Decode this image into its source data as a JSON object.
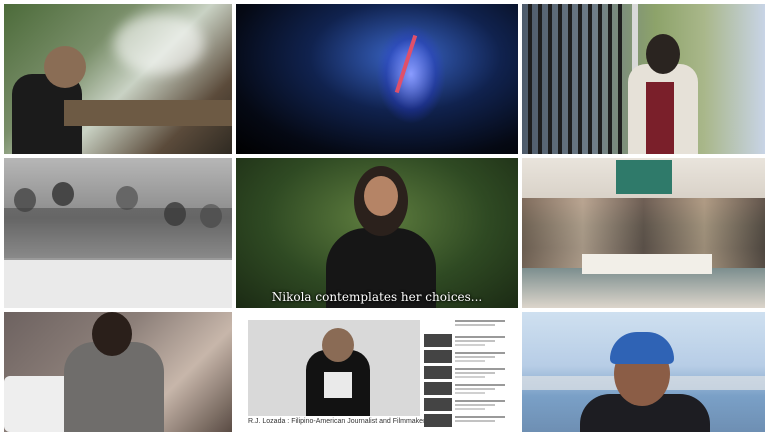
{
  "collage": {
    "subtitle_text": "Nikola contemplates her choices...",
    "youtube_caption": "R.J. Lozada : Filipino-American Journalist and Filmmaker"
  }
}
